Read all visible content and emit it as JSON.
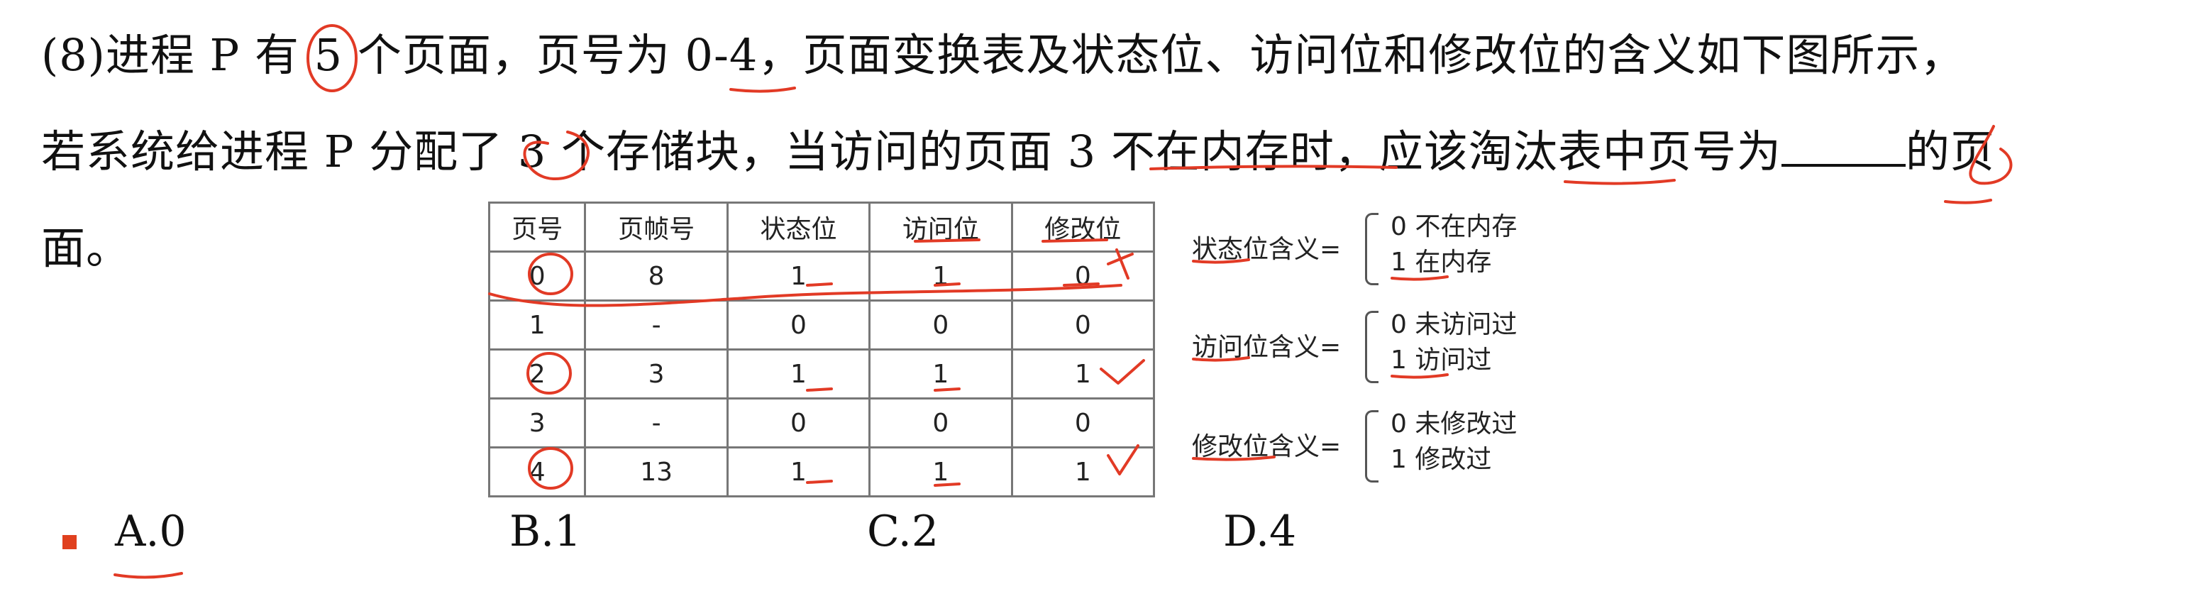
{
  "question": {
    "line1": "(8)进程 P 有 5 个页面，页号为 0-4，页面变换表及状态位、访问位和修改位的含义如下图所示，",
    "line2_before_blank": "若系统给进程 P 分配了 3 个存储块，当访问的页面 3 不在内存时，应该淘汰表中页号为",
    "line2_after_blank": "的页",
    "line3": "面。"
  },
  "table": {
    "headers": [
      "页号",
      "页帧号",
      "状态位",
      "访问位",
      "修改位"
    ],
    "rows": [
      [
        "0",
        "8",
        "1",
        "1",
        "0"
      ],
      [
        "1",
        "-",
        "0",
        "0",
        "0"
      ],
      [
        "2",
        "3",
        "1",
        "1",
        "1"
      ],
      [
        "3",
        "-",
        "0",
        "0",
        "0"
      ],
      [
        "4",
        "13",
        "1",
        "1",
        "1"
      ]
    ]
  },
  "legend": [
    {
      "name": "状态位含义=",
      "options": [
        "0 不在内存",
        "1 在内存"
      ]
    },
    {
      "name": "访问位含义=",
      "options": [
        "0 未访问过",
        "1 访问过"
      ]
    },
    {
      "name": "修改位含义=",
      "options": [
        "0 未修改过",
        "1 修改过"
      ]
    }
  ],
  "choices": [
    "A.0",
    "B.1",
    "C.2",
    "D.4"
  ],
  "colors": {
    "annotation": "#e23a25",
    "bullet": "#e0401e",
    "text": "#111111",
    "table_border": "#777777"
  }
}
